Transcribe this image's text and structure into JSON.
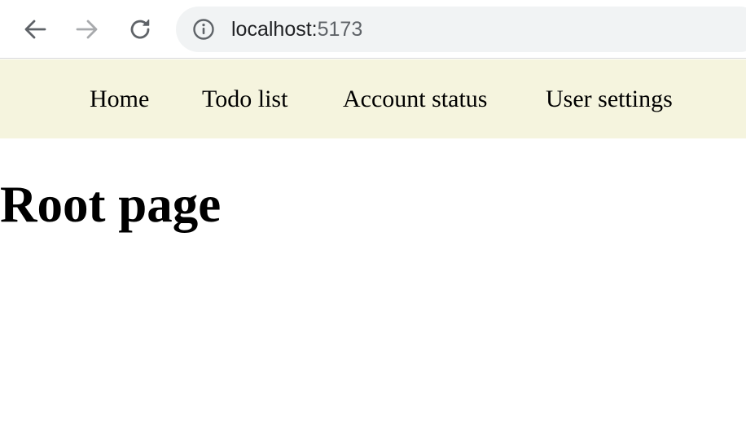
{
  "browser": {
    "url_host": "localhost:",
    "url_port": "5173",
    "icons": {
      "back": "arrow-left-icon",
      "forward": "arrow-right-icon",
      "reload": "reload-icon",
      "site_info": "info-icon"
    }
  },
  "nav": {
    "links": [
      {
        "label": "Home"
      },
      {
        "label": "Todo list"
      },
      {
        "label": "Account status"
      },
      {
        "label": "User settings"
      }
    ],
    "background": "#f5f4de"
  },
  "main": {
    "title": "Root page"
  }
}
